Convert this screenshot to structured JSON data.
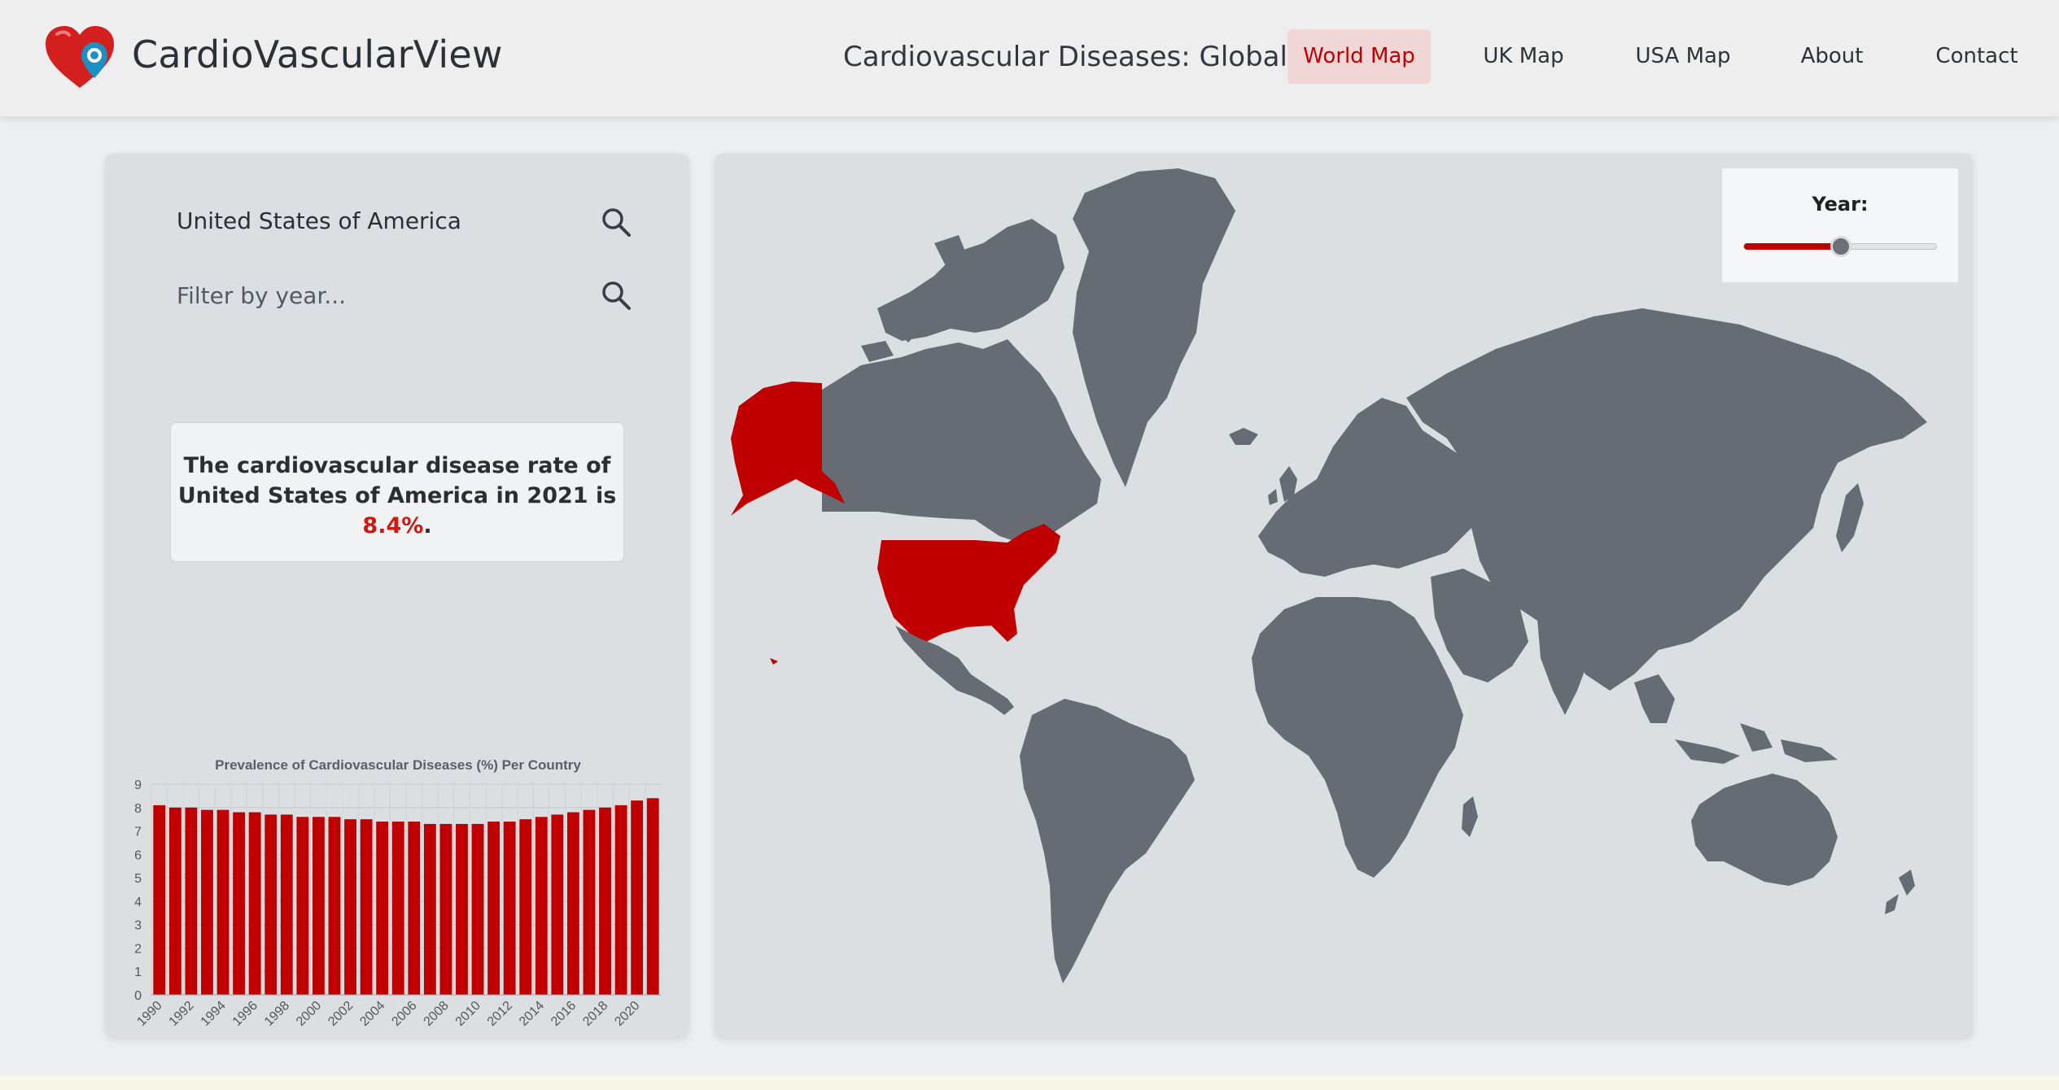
{
  "header": {
    "brand": "CardioVascularView",
    "title": "Cardiovascular Diseases: Global",
    "nav": [
      "World Map",
      "UK Map",
      "USA Map",
      "About",
      "Contact"
    ],
    "active_nav": "World Map"
  },
  "sidebar": {
    "country_search_value": "United States of America",
    "year_filter_placeholder": "Filter by year...",
    "info": {
      "prefix": "The cardiovascular disease rate of United States of America in 2021 is",
      "rate": "8.4%",
      "suffix": "."
    }
  },
  "year_slider": {
    "label": "Year:",
    "level_fraction": 0.5
  },
  "colors": {
    "accent": "#c00000",
    "land": "#676c74",
    "ocean": "#dcdfe2",
    "panel": "#dcdfe2"
  },
  "map": {
    "highlighted_country": "United States of America"
  },
  "chart_data": {
    "type": "bar",
    "title": "Prevalence of Cardiovascular Diseases (%) Per Country",
    "categories": [
      "1990",
      "1991",
      "1992",
      "1993",
      "1994",
      "1995",
      "1996",
      "1997",
      "1998",
      "1999",
      "2000",
      "2001",
      "2002",
      "2003",
      "2004",
      "2005",
      "2006",
      "2007",
      "2008",
      "2009",
      "2010",
      "2011",
      "2012",
      "2013",
      "2014",
      "2015",
      "2016",
      "2017",
      "2018",
      "2019",
      "2020",
      "2021"
    ],
    "x_tick_labels": [
      "1990",
      "1992",
      "1994",
      "1996",
      "1998",
      "2000",
      "2002",
      "2004",
      "2006",
      "2008",
      "2010",
      "2012",
      "2014",
      "2016",
      "2018",
      "2020"
    ],
    "values": [
      8.1,
      8.0,
      8.0,
      7.9,
      7.9,
      7.8,
      7.8,
      7.7,
      7.7,
      7.6,
      7.6,
      7.6,
      7.5,
      7.5,
      7.4,
      7.4,
      7.4,
      7.3,
      7.3,
      7.3,
      7.3,
      7.4,
      7.4,
      7.5,
      7.6,
      7.7,
      7.8,
      7.9,
      8.0,
      8.1,
      8.3,
      8.4
    ],
    "ylim": [
      0,
      9
    ],
    "y_ticks": [
      0,
      1,
      2,
      3,
      4,
      5,
      6,
      7,
      8,
      9
    ],
    "grid": true,
    "bar_color": "#c00000"
  }
}
